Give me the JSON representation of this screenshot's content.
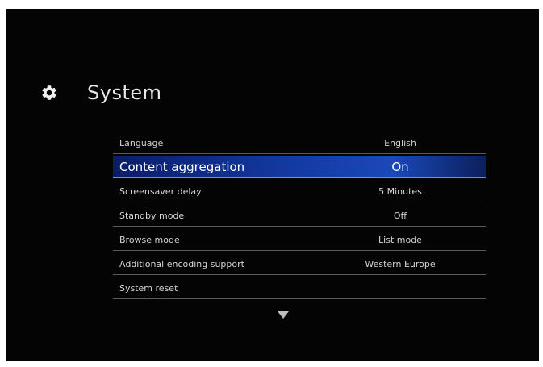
{
  "header": {
    "icon": "gear-icon",
    "title": "System"
  },
  "menu": {
    "selected_index": 1,
    "items": [
      {
        "label": "Language",
        "value": "English"
      },
      {
        "label": "Content aggregation",
        "value": "On"
      },
      {
        "label": "Screensaver delay",
        "value": "5 Minutes"
      },
      {
        "label": "Standby mode",
        "value": "Off"
      },
      {
        "label": "Browse mode",
        "value": "List mode"
      },
      {
        "label": "Additional encoding support",
        "value": "Western Europe"
      },
      {
        "label": "System reset",
        "value": ""
      }
    ]
  },
  "scroll": {
    "icon": "scroll-down-arrow-icon"
  },
  "colors": {
    "background": "#040404",
    "highlight": "#13389e",
    "text": "#d6d6d6"
  }
}
